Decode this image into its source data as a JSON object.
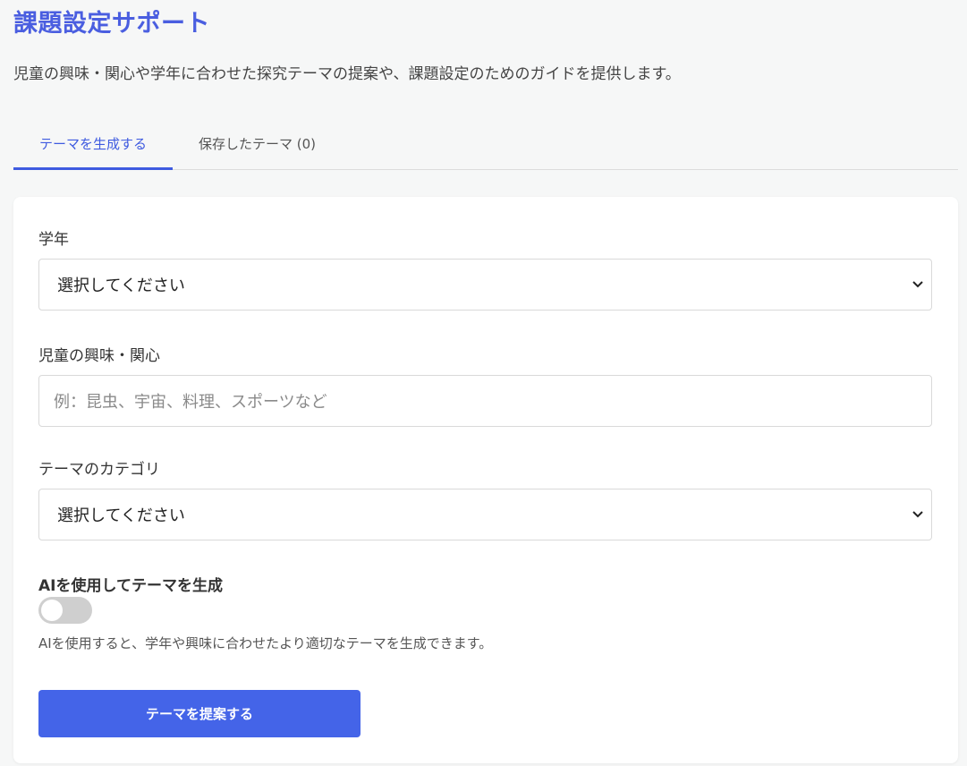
{
  "header": {
    "title": "課題設定サポート",
    "subtitle": "児童の興味・関心や学年に合わせた探究テーマの提案や、課題設定のためのガイドを提供します。"
  },
  "tabs": [
    {
      "label": "テーマを生成する",
      "active": true
    },
    {
      "label": "保存したテーマ (0)",
      "active": false
    }
  ],
  "form": {
    "grade": {
      "label": "学年",
      "value": "選択してください"
    },
    "interests": {
      "label": "児童の興味・関心",
      "placeholder": "例：昆虫、宇宙、料理、スポーツなど",
      "value": ""
    },
    "category": {
      "label": "テーマのカテゴリ",
      "value": "選択してください"
    },
    "ai": {
      "label": "AIを使用してテーマを生成",
      "enabled": false,
      "help": "AIを使用すると、学年や興味に合わせたより適切なテーマを生成できます。"
    },
    "submit_label": "テーマを提案する"
  },
  "colors": {
    "accent": "#3f5be0",
    "button": "#4464e8",
    "background": "#f6f7f7"
  }
}
